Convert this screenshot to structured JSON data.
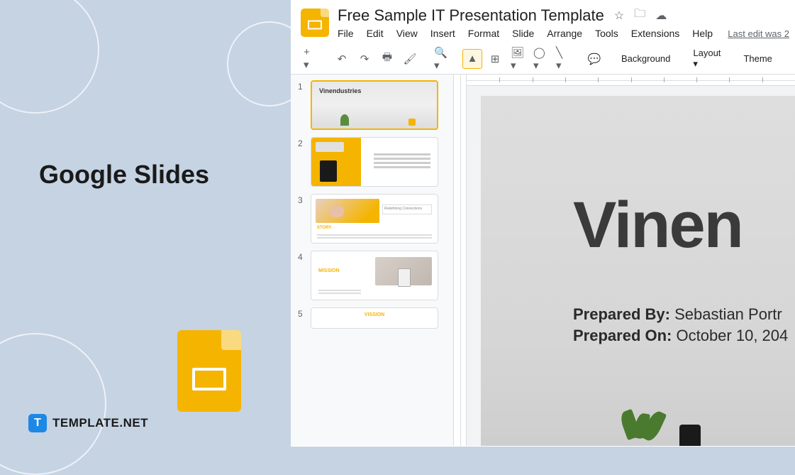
{
  "left": {
    "title": "Google Slides",
    "badge_text": "TEMPLATE.NET",
    "badge_icon_letter": "T"
  },
  "header": {
    "doc_title": "Free Sample IT Presentation Template",
    "menu": {
      "file": "File",
      "edit": "Edit",
      "view": "View",
      "insert": "Insert",
      "format": "Format",
      "slide": "Slide",
      "arrange": "Arrange",
      "tools": "Tools",
      "extensions": "Extensions",
      "help": "Help"
    },
    "last_edit": "Last edit was 2"
  },
  "toolbar": {
    "background": "Background",
    "layout": "Layout",
    "theme": "Theme"
  },
  "thumbs": {
    "n1": "1",
    "n2": "2",
    "n3": "3",
    "n4": "4",
    "n5": "5",
    "t1_title": "Vinendustries",
    "t2_title": "",
    "t3_label": "STORY",
    "t3_box": "Redefining Connections",
    "t4_label": "MISSION",
    "t5_label": "VISSION"
  },
  "slide": {
    "title": "Vinen",
    "prep_by_label": "Prepared By:",
    "prep_by_value": " Sebastian Portr",
    "prep_on_label": "Prepared On:",
    "prep_on_value": " October 10, 204"
  }
}
